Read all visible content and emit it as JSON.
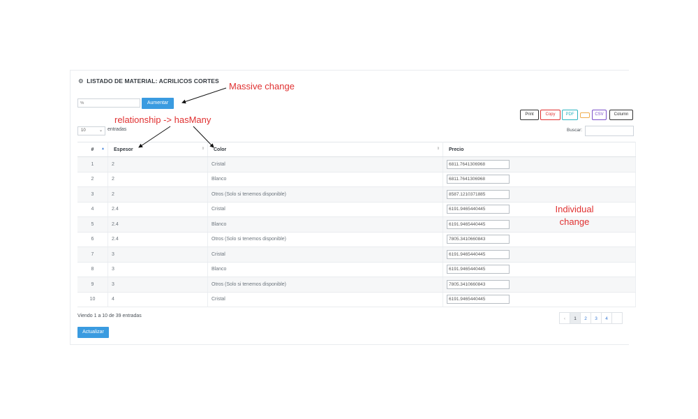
{
  "header": {
    "title": "LISTADO DE MATERIAL: ACRILICOS CORTES",
    "icon": "gear-icon"
  },
  "increase": {
    "placeholder": "%",
    "button_label": "Aumentar"
  },
  "export_buttons": [
    {
      "label": "Print",
      "color": "#333333"
    },
    {
      "label": "Copy",
      "color": "#e03131"
    },
    {
      "label": "PDF",
      "color": "#2bb3c0"
    },
    {
      "label": "",
      "color": "#f0ad4e"
    },
    {
      "label": "CSV",
      "color": "#7b4fc9"
    },
    {
      "label": "Column",
      "color": "#333333"
    }
  ],
  "length": {
    "value": "10",
    "label": "entradas"
  },
  "search": {
    "label": "Buscar:"
  },
  "table": {
    "columns": [
      "#",
      "Espesor",
      "Color",
      "Precio"
    ],
    "rows": [
      {
        "n": "1",
        "espesor": "2",
        "color": "Cristal",
        "precio": "6811.7641306968"
      },
      {
        "n": "2",
        "espesor": "2",
        "color": "Blanco",
        "precio": "6811.7641306968"
      },
      {
        "n": "3",
        "espesor": "2",
        "color": "Otros (Solo si tenemos disponible)",
        "precio": "8587.1210371885"
      },
      {
        "n": "4",
        "espesor": "2.4",
        "color": "Cristal",
        "precio": "6191.9465440445"
      },
      {
        "n": "5",
        "espesor": "2.4",
        "color": "Blanco",
        "precio": "6191.9465440445"
      },
      {
        "n": "6",
        "espesor": "2.4",
        "color": "Otros (Solo si tenemos disponible)",
        "precio": "7805.3410660843"
      },
      {
        "n": "7",
        "espesor": "3",
        "color": "Cristal",
        "precio": "6191.9465440445"
      },
      {
        "n": "8",
        "espesor": "3",
        "color": "Blanco",
        "precio": "6191.9465440445"
      },
      {
        "n": "9",
        "espesor": "3",
        "color": "Otros (Solo si tenemos disponible)",
        "precio": "7805.3410660843"
      },
      {
        "n": "10",
        "espesor": "4",
        "color": "Cristal",
        "precio": "6191.9465440445"
      }
    ]
  },
  "info": "Viendo 1 a 10 de 39 entradas",
  "pagination": {
    "prev": "‹",
    "pages": [
      "1",
      "2",
      "3",
      "4"
    ],
    "active": "1"
  },
  "update_button": "Actualizar",
  "annotations": {
    "massive": "Massive change",
    "relationship": "relationship -> hasMany",
    "individual_1": "Individual",
    "individual_2": "change"
  },
  "colors": {
    "accent": "#3a9be0",
    "annotation": "#e03131"
  }
}
